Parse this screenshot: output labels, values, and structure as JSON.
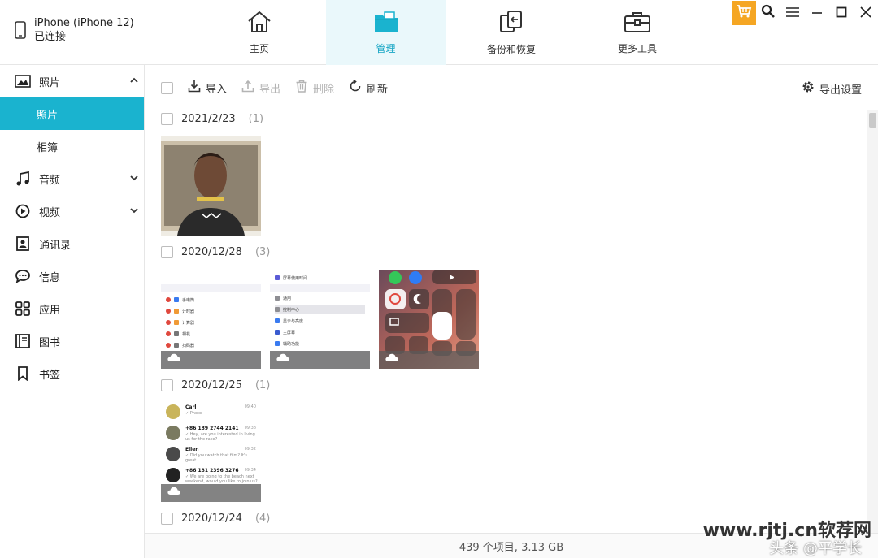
{
  "device": {
    "name": "iPhone (iPhone 12)",
    "status": "已连接"
  },
  "nav": {
    "tabs": [
      {
        "label": "主页",
        "icon": "home-icon"
      },
      {
        "label": "管理",
        "icon": "folder-icon",
        "active": true
      },
      {
        "label": "备份和恢复",
        "icon": "backup-restore-icon"
      },
      {
        "label": "更多工具",
        "icon": "toolbox-icon"
      }
    ]
  },
  "window_controls": [
    "cart-icon",
    "search-icon",
    "menu-icon",
    "minimize-icon",
    "maximize-icon",
    "close-icon"
  ],
  "sidebar": {
    "items": [
      {
        "label": "照片",
        "icon": "photo-icon",
        "expanded": true,
        "children": [
          {
            "label": "照片",
            "active": true
          },
          {
            "label": "相簿"
          }
        ]
      },
      {
        "label": "音频",
        "icon": "music-icon",
        "collapsible": true
      },
      {
        "label": "视频",
        "icon": "video-icon",
        "collapsible": true
      },
      {
        "label": "通讯录",
        "icon": "contacts-icon"
      },
      {
        "label": "信息",
        "icon": "message-icon"
      },
      {
        "label": "应用",
        "icon": "apps-icon"
      },
      {
        "label": "图书",
        "icon": "book-icon"
      },
      {
        "label": "书签",
        "icon": "bookmark-icon"
      }
    ]
  },
  "toolbar": {
    "import": "导入",
    "export": "导出",
    "delete": "删除",
    "refresh": "刷新",
    "export_settings": "导出设置"
  },
  "groups": [
    {
      "date": "2021/2/23",
      "count": "(1)"
    },
    {
      "date": "2020/12/28",
      "count": "(3)"
    },
    {
      "date": "2020/12/25",
      "count": "(1)"
    },
    {
      "date": "2020/12/24",
      "count": "(4)"
    }
  ],
  "thumb_text": {
    "settings_rows": [
      "手电筒",
      "计时器",
      "计算器",
      "相机",
      "扫码器"
    ],
    "settings2_rows": [
      "屏幕使用时间",
      "通用",
      "控制中心",
      "显示与亮度",
      "主屏幕",
      "辅助功能"
    ],
    "chats": [
      {
        "name": "Carl",
        "msg": "✓ Photo",
        "time": "09:40"
      },
      {
        "name": "+86 189 2744 2141",
        "msg": "✓ Hey, are you interested in living us for the race?",
        "time": "09:38"
      },
      {
        "name": "Ellen",
        "msg": "✓ Did you watch that film? It's great",
        "time": "09:32"
      },
      {
        "name": "+86 181 2396 3276",
        "msg": "✓ We are going to the beach next weekend, would you like to join us?",
        "time": "09:34"
      }
    ]
  },
  "status": {
    "summary": "439 个项目, 3.13 GB"
  },
  "watermark": {
    "line1": "www.rjtj.cn软荐网",
    "line2": "头条 @平学长"
  },
  "colors": {
    "accent": "#1ab3cf",
    "cart": "#f5a623"
  }
}
